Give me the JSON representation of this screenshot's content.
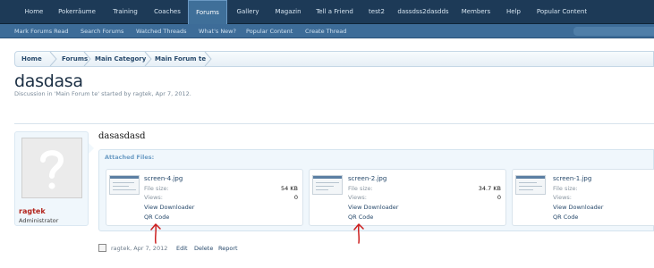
{
  "top_nav": {
    "tabs": [
      {
        "label": "Home"
      },
      {
        "label": "Pokerräume"
      },
      {
        "label": "Training"
      },
      {
        "label": "Coaches"
      },
      {
        "label": "Forums",
        "active": true
      },
      {
        "label": "Gallery"
      },
      {
        "label": "Magazin"
      },
      {
        "label": "Tell a Friend"
      },
      {
        "label": "test2"
      },
      {
        "label": "dassdss2dasdds"
      },
      {
        "label": "Members"
      },
      {
        "label": "Help"
      },
      {
        "label": "Popular Content"
      }
    ]
  },
  "sub_nav": {
    "links": [
      {
        "label": "Mark Forums Read"
      },
      {
        "label": "Search Forums"
      },
      {
        "label": "Watched Threads"
      },
      {
        "label": "What's New?"
      },
      {
        "label": "Popular Content"
      },
      {
        "label": "Create Thread"
      }
    ]
  },
  "breadcrumb": {
    "items": [
      {
        "label": "Home"
      },
      {
        "label": "Forums"
      },
      {
        "label": "Main Category"
      },
      {
        "label": "Main Forum te"
      }
    ]
  },
  "thread": {
    "title": "dasdasa",
    "description": "Discussion in 'Main Forum te' started by ragtek, Apr 7, 2012."
  },
  "post": {
    "user": {
      "name": "ragtek",
      "title": "Administrator"
    },
    "message": "dasasdasd",
    "attachments_heading": "Attached Files:",
    "attachments": [
      {
        "filename": "screen-4.jpg",
        "size_label": "File size:",
        "size": "54 KB",
        "views_label": "Views:",
        "views": "0",
        "download": "View Downloader",
        "qr": "QR Code"
      },
      {
        "filename": "screen-2.jpg",
        "size_label": "File size:",
        "size": "34.7 KB",
        "views_label": "Views:",
        "views": "0",
        "download": "View Downloader",
        "qr": "QR Code"
      },
      {
        "filename": "screen-1.jpg",
        "size_label": "File size:",
        "size": "",
        "views_label": "Views:",
        "views": "",
        "download": "View Downloader",
        "qr": "QR Code"
      }
    ],
    "footer": {
      "author_date": "ragtek, Apr 7, 2012",
      "edit": "Edit",
      "delete": "Delete",
      "report": "Report"
    }
  },
  "colors": {
    "nav_bg": "#1d3a57",
    "nav_active": "#3f6f99",
    "subnav_bg": "#3d6c98",
    "link": "#27496b",
    "username": "#b3261e",
    "annotation_arrow": "#cc1f1f"
  },
  "annotations": {
    "arrows": 2
  }
}
